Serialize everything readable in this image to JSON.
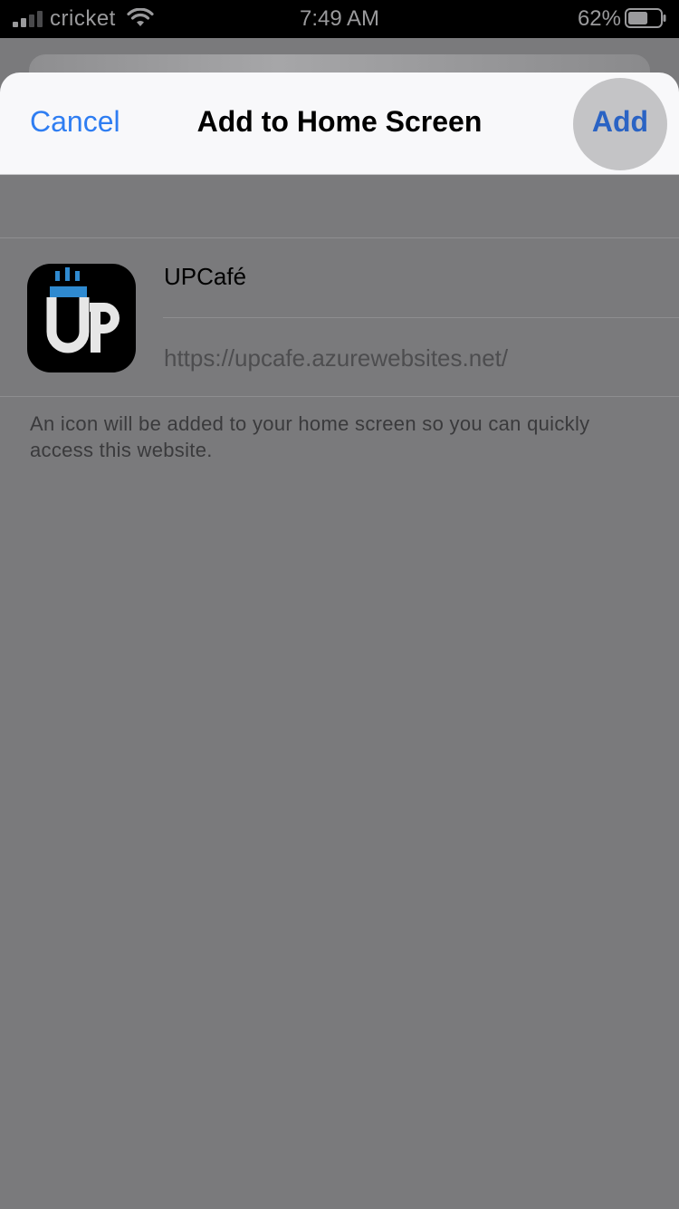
{
  "status_bar": {
    "carrier": "cricket",
    "time": "7:49 AM",
    "battery_percent": "62%",
    "battery_level": 0.62
  },
  "nav": {
    "cancel_label": "Cancel",
    "title": "Add to Home Screen",
    "add_label": "Add"
  },
  "shortcut": {
    "name": "UPCafé",
    "url": "https://upcafe.azurewebsites.net/"
  },
  "hint": "An icon will be added to your home screen so you can quickly access this website.",
  "colors": {
    "accent": "#2e7df2",
    "add_button": "#2a63c4",
    "dimmed_background": "#7a7a7c"
  }
}
